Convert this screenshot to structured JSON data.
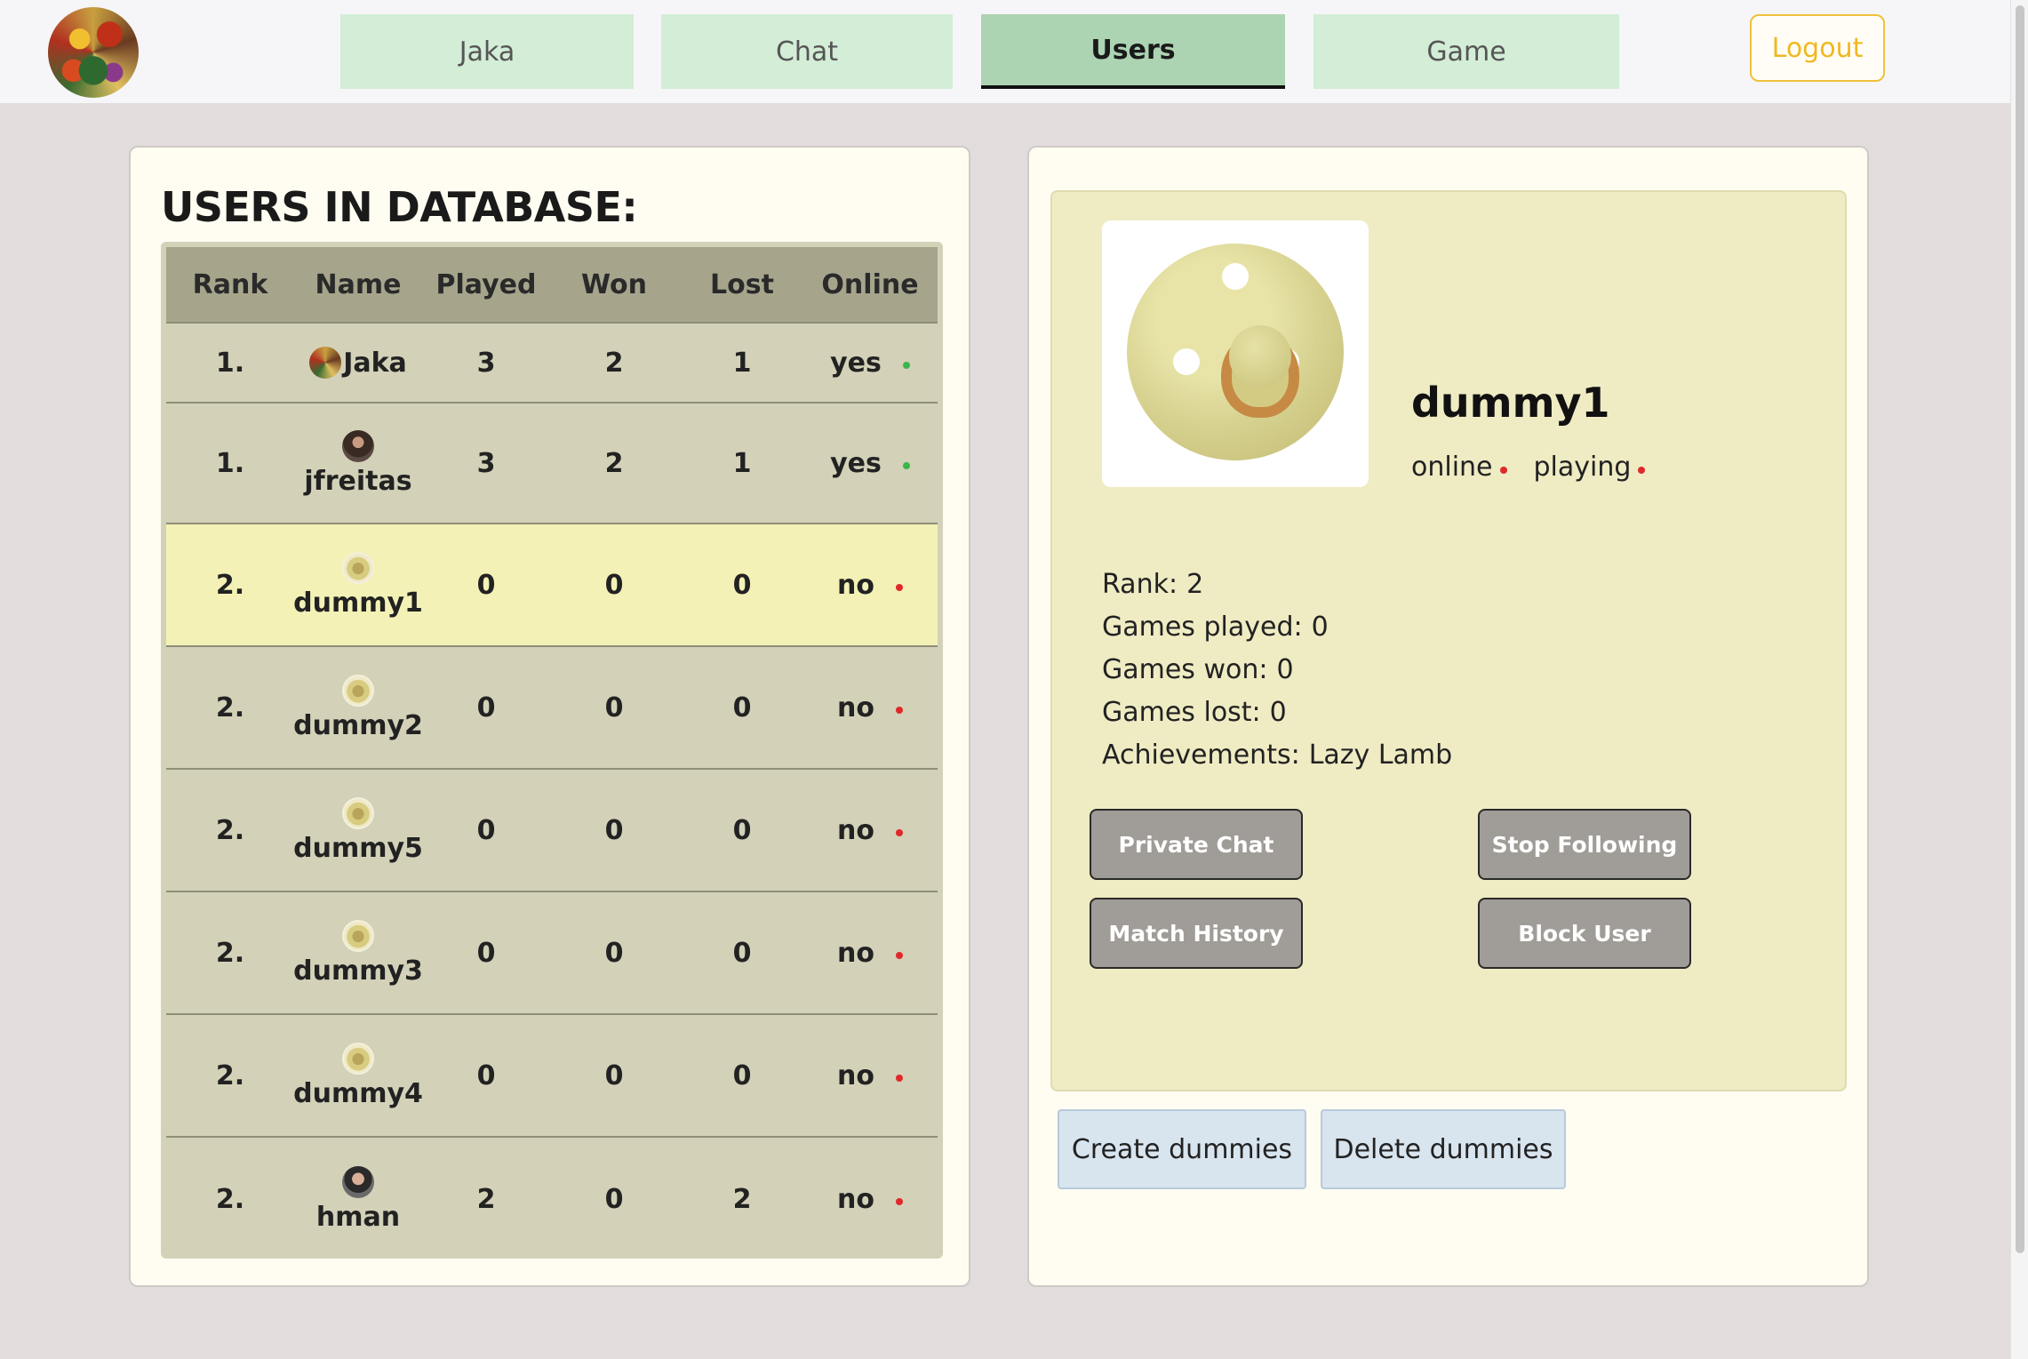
{
  "nav": {
    "tabs": [
      {
        "label": "Jaka"
      },
      {
        "label": "Chat"
      },
      {
        "label": "Users"
      },
      {
        "label": "Game"
      }
    ],
    "active_tab": "Users",
    "logout_label": "Logout"
  },
  "users_panel": {
    "title": "USERS IN DATABASE:",
    "columns": [
      "Rank",
      "Name",
      "Played",
      "Won",
      "Lost",
      "Online"
    ],
    "rows": [
      {
        "rank": "1.",
        "name": "Jaka",
        "played": "3",
        "won": "2",
        "lost": "1",
        "online": "yes",
        "online_color": "#3ab64a",
        "avatar": "painting-avatar"
      },
      {
        "rank": "1.",
        "name": "jfreitas",
        "played": "3",
        "won": "2",
        "lost": "1",
        "online": "yes",
        "online_color": "#3ab64a",
        "avatar": "person-avatar"
      },
      {
        "rank": "2.",
        "name": "dummy1",
        "played": "0",
        "won": "0",
        "lost": "0",
        "online": "no",
        "online_color": "#e0282a",
        "avatar": "pacifier-avatar",
        "selected": true
      },
      {
        "rank": "2.",
        "name": "dummy2",
        "played": "0",
        "won": "0",
        "lost": "0",
        "online": "no",
        "online_color": "#e0282a",
        "avatar": "pacifier-avatar"
      },
      {
        "rank": "2.",
        "name": "dummy5",
        "played": "0",
        "won": "0",
        "lost": "0",
        "online": "no",
        "online_color": "#e0282a",
        "avatar": "pacifier-avatar"
      },
      {
        "rank": "2.",
        "name": "dummy3",
        "played": "0",
        "won": "0",
        "lost": "0",
        "online": "no",
        "online_color": "#e0282a",
        "avatar": "pacifier-avatar"
      },
      {
        "rank": "2.",
        "name": "dummy4",
        "played": "0",
        "won": "0",
        "lost": "0",
        "online": "no",
        "online_color": "#e0282a",
        "avatar": "pacifier-avatar"
      },
      {
        "rank": "2.",
        "name": "hman",
        "played": "2",
        "won": "0",
        "lost": "2",
        "online": "no",
        "online_color": "#e0282a",
        "avatar": "person-avatar"
      }
    ]
  },
  "profile": {
    "username": "dummy1",
    "status_online_label": "online",
    "status_playing_label": "playing",
    "stats": [
      {
        "label": "Rank:",
        "value": "2"
      },
      {
        "label": "Games played:",
        "value": "0"
      },
      {
        "label": "Games won:",
        "value": "0"
      },
      {
        "label": "Games lost:",
        "value": "0"
      },
      {
        "label": "Achievements:",
        "value": "Lazy Lamb"
      }
    ],
    "buttons": {
      "private_chat": "Private Chat",
      "stop_following": "Stop Following",
      "match_history": "Match History",
      "block_user": "Block User"
    }
  },
  "dummies": {
    "create_label": "Create dummies",
    "delete_label": "Delete dummies"
  },
  "colors": {
    "online_dot": "#3ab64a",
    "offline_dot": "#e0282a",
    "nav_tab": "#d3edd6",
    "nav_tab_active": "#acd3b2",
    "logout_accent": "#f0b820"
  }
}
